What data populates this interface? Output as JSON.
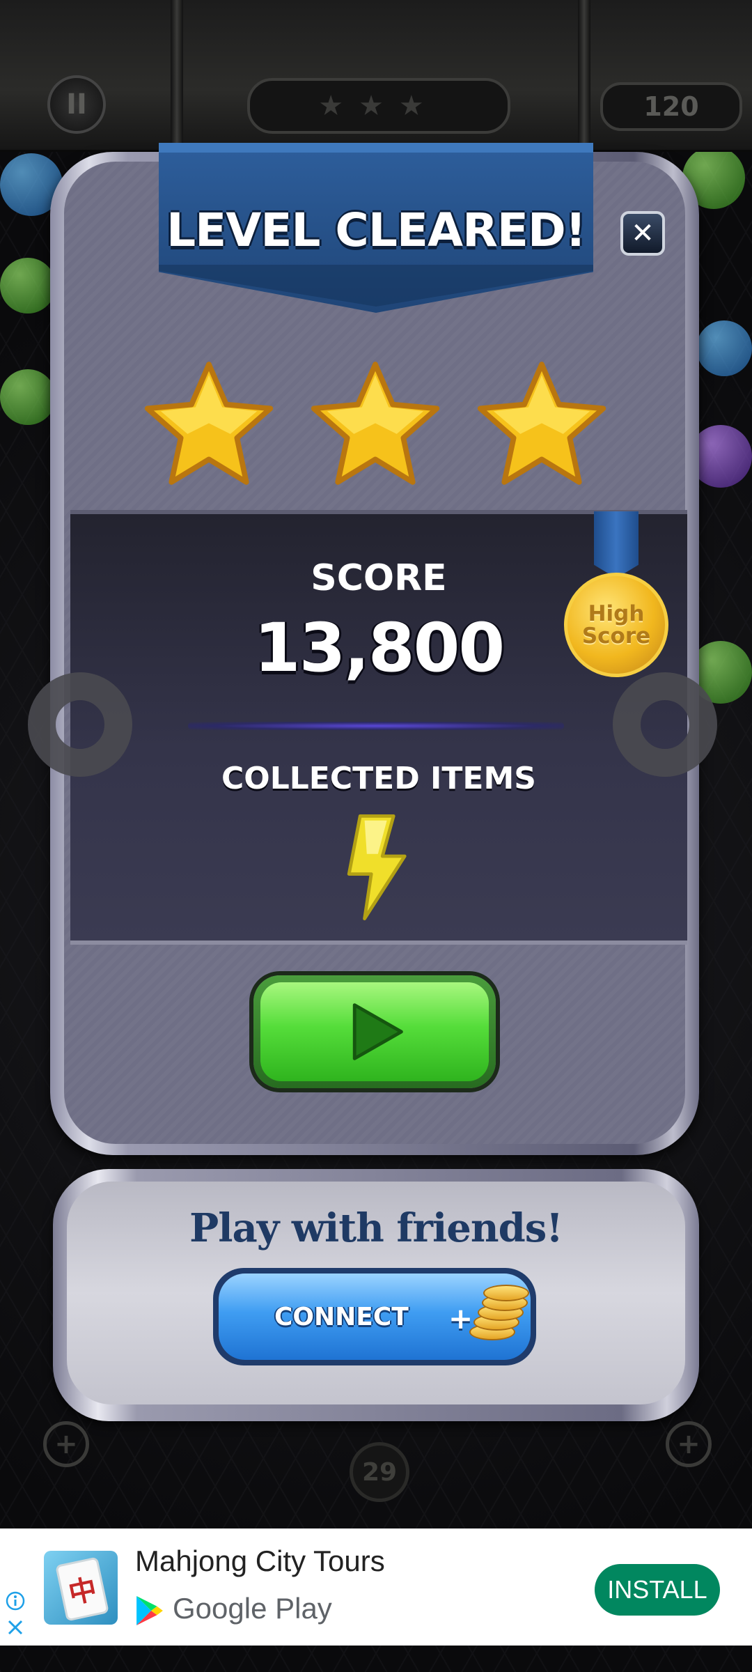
{
  "hud": {
    "pause_icon": "pause-icon",
    "stars_earned": 0,
    "moves": "120",
    "bottom_counter": "29"
  },
  "dialog": {
    "title": "LEVEL CLEARED!",
    "close_icon": "close-icon",
    "stars_earned": 3,
    "stars_total": 3,
    "score_label": "SCORE",
    "score_value": "13,800",
    "badge_line1": "High",
    "badge_line2": "Score",
    "collected_label": "COLLECTED ITEMS",
    "collected_items": [
      "lightning-bolt"
    ],
    "play_icon": "play-icon"
  },
  "friends": {
    "title": "Play with friends!",
    "connect_label": "CONNECT",
    "reward_prefix": "+",
    "reward_icon": "coins-icon"
  },
  "ad": {
    "app_name": "Mahjong City Tours",
    "store_name": "Google Play",
    "install_label": "INSTALL",
    "install_color": "#01875f"
  },
  "colors": {
    "banner": "#2d5d9a",
    "play_green": "#55dd3a",
    "connect_blue": "#3f9df2",
    "star_gold": "#f6c21b"
  }
}
